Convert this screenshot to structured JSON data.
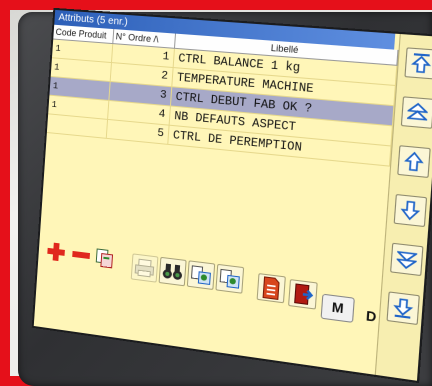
{
  "window": {
    "title": "Attributs (5 enr.)"
  },
  "table": {
    "columns": [
      "Code Produit",
      "N° Ordre /\\",
      "Libellé"
    ],
    "rows": [
      {
        "code": "1",
        "ordre": "1",
        "libelle": "CTRL BALANCE  1 kg",
        "selected": false
      },
      {
        "code": "1",
        "ordre": "2",
        "libelle": "TEMPERATURE MACHINE",
        "selected": false
      },
      {
        "code": "1",
        "ordre": "3",
        "libelle": "CTRL DEBUT FAB OK ?",
        "selected": true
      },
      {
        "code": "1",
        "ordre": "4",
        "libelle": "NB DEFAUTS ASPECT",
        "selected": false
      },
      {
        "code": "",
        "ordre": "5",
        "libelle": "CTRL DE PEREMPTION",
        "selected": false
      }
    ]
  },
  "toolbar": {
    "m_label": "M",
    "d_label": "D"
  },
  "icons": {
    "add": "plus-icon",
    "remove": "minus-icon",
    "copy": "copy-record-icon",
    "print": "printer-icon",
    "find": "binoculars-icon",
    "export": "export-icon",
    "document": "document-icon",
    "exit": "exit-door-icon",
    "first": "first-page-icon",
    "page_up": "page-up-icon",
    "up": "up-arrow-icon",
    "down": "down-arrow-icon",
    "page_down": "page-down-icon",
    "last": "last-page-icon"
  },
  "colors": {
    "frame": "#e5101a",
    "screen_bg": "#fff6b8",
    "selected_row": "#a7a9c8",
    "title_bar": "#2c5fb8",
    "add_red": "#e0271d",
    "arrow_blue": "#1f64c8"
  }
}
